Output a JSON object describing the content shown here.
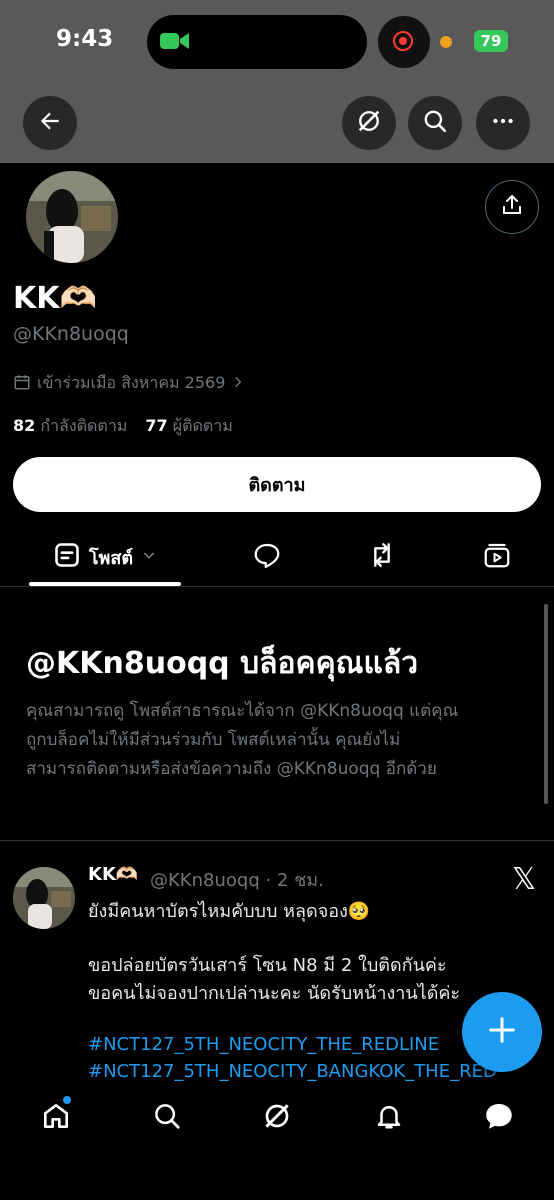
{
  "status_bar": {
    "time": "9:43",
    "battery": "79"
  },
  "top_bar": {
    "back": "back-arrow-icon",
    "grok": "grok-icon",
    "search": "search-icon",
    "more": "more-icon"
  },
  "profile": {
    "display_name": "KK🫶🏻",
    "handle": "@KKn8uoqq",
    "joined": "เข้าร่วมเมือ สิงหาคม 2569",
    "following_count": "82",
    "following_label": "กำลังติดตาม",
    "followers_count": "77",
    "followers_label": "ผู้ติดตาม",
    "follow_button": "ติดตาม"
  },
  "tabs": [
    {
      "label": "โพสต์",
      "icon": "posts-icon",
      "active": true
    },
    {
      "icon": "replies-icon"
    },
    {
      "icon": "repost-icon"
    },
    {
      "icon": "media-icon"
    }
  ],
  "blocked_notice": {
    "title": "@KKn8uoqq บล็อคคุณแล้ว",
    "body_lines": [
      "คุณสามารถดู โพสต์สาธารณะได้จาก @KKn8uoqq แต่คุณ",
      "ถูกบล็อคไม่ให้มีส่วนร่วมกับ โพสต์เหล่านั้น คุณยังไม่",
      "สามารถติดตามหรือส่งข้อความถึง @KKn8uoqq อีกด้วย"
    ]
  },
  "tweet": {
    "name": "KK🫶🏻",
    "handle_time": "@KKn8uoqq · 2 ชม.",
    "lines": [
      "ยังมีคนหาบัตรไหมคับบบ หลุดจอง🥺",
      "",
      "ขอปล่อยบัตรวันเสาร์ โซน N8 มี 2 ใบติดกันค่ะ",
      "ขอคนไม่จองปากเปล่านะคะ นัดรับหน้างานได้ค่ะ",
      ""
    ],
    "hashtags": [
      "#NCT127_5TH_NEOCITY_THE_REDLINE",
      "#NCT127_5TH_NEOCITY_BANGKOK_THE_RED"
    ],
    "platform": "𝕏"
  },
  "bottom_nav": [
    "home-icon",
    "search-icon",
    "grok-icon",
    "notifications-icon",
    "messages-icon"
  ],
  "colors": {
    "accent": "#1d9bf0",
    "muted": "#71767b",
    "background": "#000000"
  }
}
